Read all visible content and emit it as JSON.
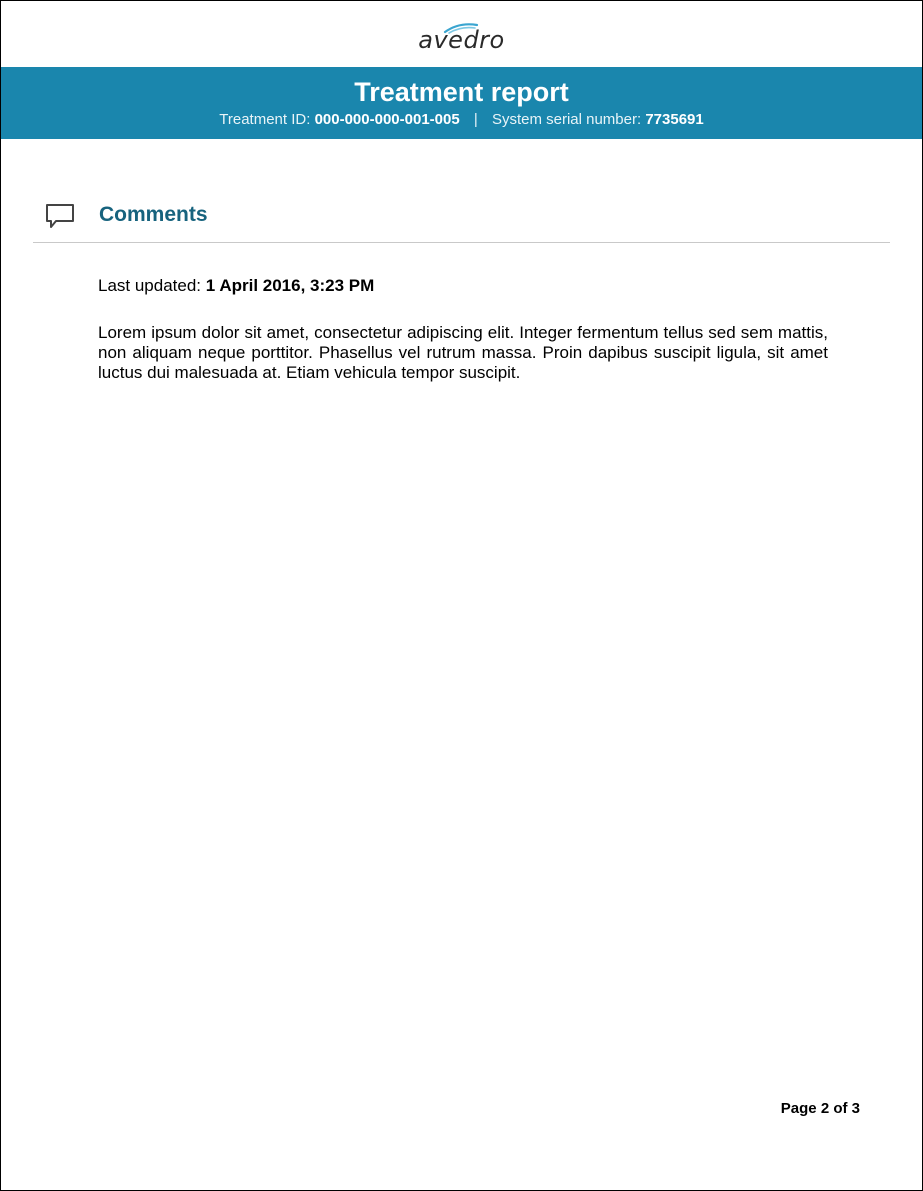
{
  "brand": {
    "logo_text": "avedro"
  },
  "header": {
    "title": "Treatment report",
    "treatment_id_label": "Treatment ID:",
    "treatment_id": "000-000-000-001-005",
    "separator": "|",
    "serial_label": "System serial number:",
    "serial_number": "7735691"
  },
  "comments": {
    "icon": "speech-bubble-icon",
    "title": "Comments",
    "updated_label": "Last updated:",
    "updated_value": "1 April 2016, 3:23 PM",
    "body": "Lorem ipsum dolor sit amet, consectetur adipiscing elit. Integer fermentum tellus sed sem mattis, non aliquam neque porttitor. Phasellus vel rutrum massa. Proin dapibus suscipit ligula, sit amet luctus dui malesuada at. Etiam vehicula tempor suscipit."
  },
  "footer": {
    "page_label": "Page 2 of 3"
  },
  "colors": {
    "header_band": "#1a86ad",
    "section_title": "#17637e",
    "logo_swoosh": "#3aa5d0"
  }
}
